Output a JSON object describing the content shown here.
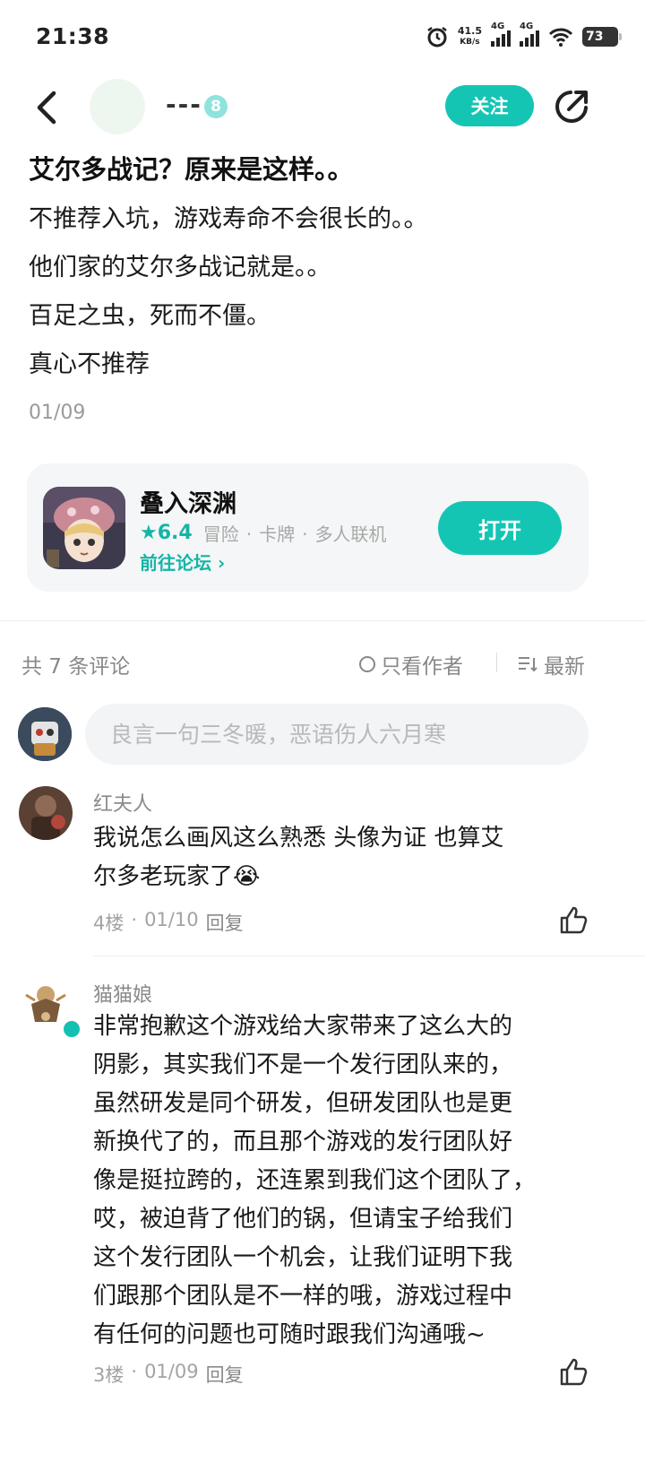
{
  "status_bar": {
    "time": "21:38",
    "net_speed_value": "41.5",
    "net_speed_unit": "KB/s",
    "sim1": "4G",
    "sim2": "4G",
    "battery": "73"
  },
  "header": {
    "author_name": "---",
    "level": "8",
    "follow_label": "关注"
  },
  "post": {
    "title": "艾尔多战记？原来是这样。。",
    "lines": [
      "不推荐入坑，游戏寿命不会很长的。。",
      "他们家的艾尔多战记就是。。",
      "百足之虫，死而不僵。",
      "真心不推荐"
    ],
    "date": "01/09"
  },
  "game_card": {
    "name": "叠入深渊",
    "rating": "6.4",
    "tags": [
      "冒险",
      "卡牌",
      "多人联机"
    ],
    "forum_link": "前往论坛",
    "open_label": "打开"
  },
  "comments_header": {
    "count_label": "共 7 条评论",
    "author_only_label": "只看作者",
    "sort_label": "最新"
  },
  "comment_input": {
    "placeholder": "良言一句三冬暖，恶语伤人六月寒"
  },
  "comments": [
    {
      "user": "红夫人",
      "text_lines": [
        "我说怎么画风这么熟悉 头像为证 也算艾",
        "尔多老玩家了😭"
      ],
      "floor": "4楼",
      "date": "01/10",
      "reply_label": "回复"
    },
    {
      "user": "猫猫娘",
      "text_lines": [
        "非常抱歉这个游戏给大家带来了这么大的",
        "阴影，其实我们不是一个发行团队来的，",
        "虽然研发是同个研发，但研发团队也是更",
        "新换代了的，而且那个游戏的发行团队好",
        "像是挺拉跨的，还连累到我们这个团队了，",
        "哎，被迫背了他们的锅，但请宝子给我们",
        "这个发行团队一个机会，让我们证明下我",
        "们跟那个团队是不一样的哦，游戏过程中",
        "有任何的问题也可随时跟我们沟通哦~"
      ],
      "floor": "3楼",
      "date": "01/09",
      "reply_label": "回复"
    }
  ],
  "colors": {
    "accent": "#15c5b4",
    "accent_text": "#15b5a6",
    "muted": "#8a8a8a"
  }
}
